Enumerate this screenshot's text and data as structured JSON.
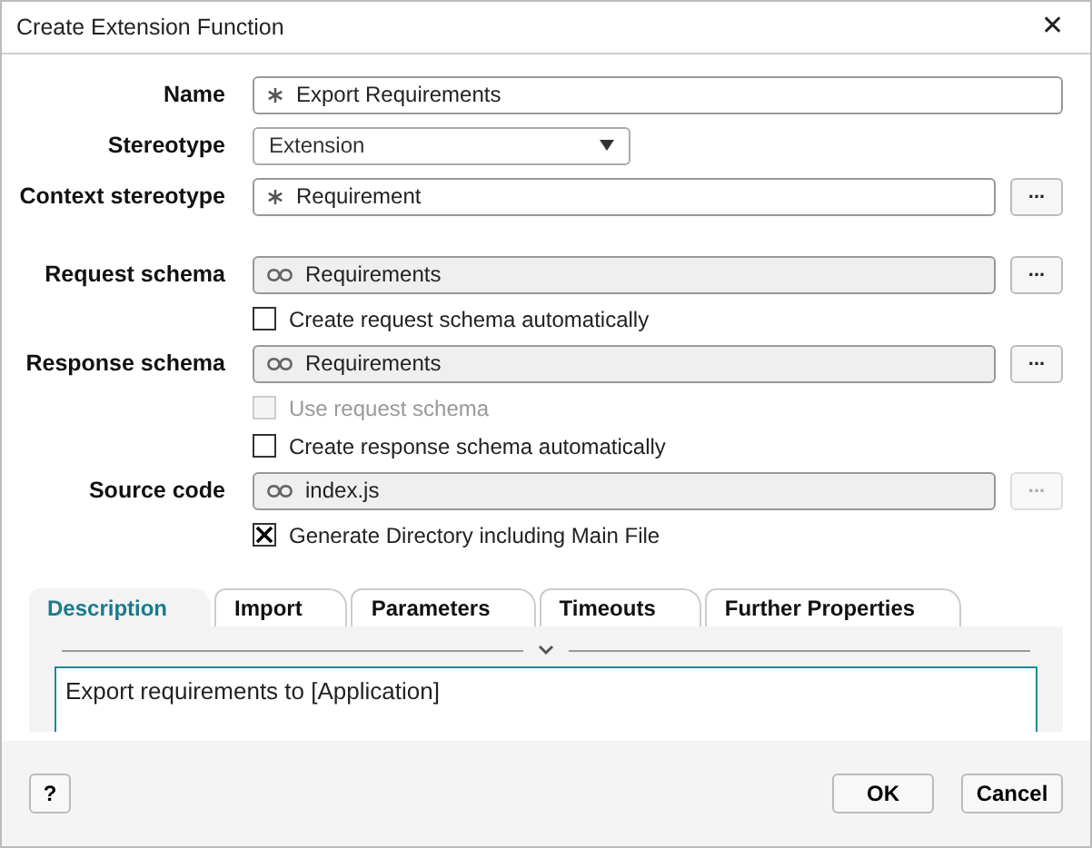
{
  "window": {
    "title": "Create Extension Function",
    "close": "✕"
  },
  "sections": [
    [
      {
        "kind": "field",
        "label": "Name",
        "value": "Export Requirements"
      },
      {
        "kind": "dropdown",
        "label": "Stereotype",
        "value": "Extension"
      },
      {
        "kind": "field",
        "label": "Context stereotype",
        "value": "Requirement",
        "browse": {
          "label": "...",
          "disabled": false
        }
      }
    ],
    [
      {
        "kind": "reference",
        "label": "Request schema",
        "value": "Requirements",
        "browse": {
          "label": "...",
          "disabled": false
        }
      },
      {
        "kind": "checkbox",
        "label": "Create request schema automatically",
        "checked": false,
        "disabled": false
      },
      {
        "kind": "reference",
        "label": "Response schema",
        "value": "Requirements",
        "browse": {
          "label": "...",
          "disabled": false
        }
      },
      {
        "kind": "checkbox",
        "label": "Use request schema",
        "checked": false,
        "disabled": true
      },
      {
        "kind": "checkbox",
        "label": "Create response schema automatically",
        "checked": false,
        "disabled": false
      },
      {
        "kind": "reference",
        "label": "Source code",
        "value": "index.js",
        "browse": {
          "label": "...",
          "disabled": true
        }
      },
      {
        "kind": "checkbox",
        "label": "Generate Directory including Main File",
        "checked": true,
        "disabled": false
      }
    ]
  ],
  "tabs": [
    {
      "label": "Description",
      "selected": true
    },
    {
      "label": "Import",
      "selected": false
    },
    {
      "label": "Parameters",
      "selected": false
    },
    {
      "label": "Timeouts",
      "selected": false
    },
    {
      "label": "Further Properties",
      "selected": false
    }
  ],
  "description": {
    "value": "Export requirements to [Application]"
  },
  "footer": {
    "help": "?",
    "ok": "OK",
    "cancel": "Cancel"
  }
}
